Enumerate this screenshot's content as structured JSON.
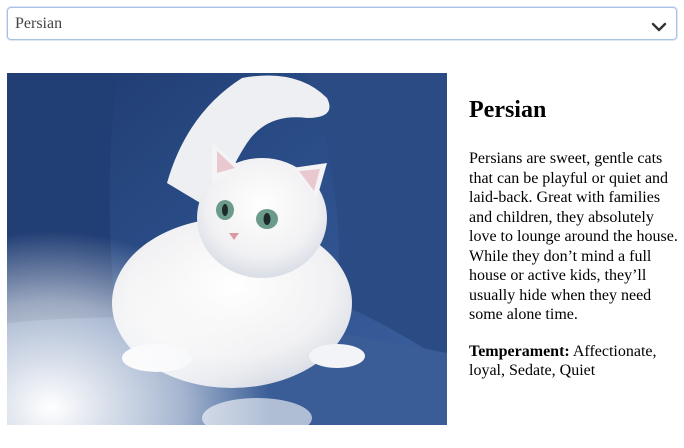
{
  "breed_select": {
    "selected": "Persian",
    "icon": "chevron-down-icon"
  },
  "photo": {
    "alt": "Persian"
  },
  "breed": {
    "name": "Persian",
    "description": "Persians are sweet, gentle cats that can be playful or quiet and laid-back. Great with families and children, they absolutely love to lounge around the house. While they don’t mind a full house or active kids, they’ll usually hide when they need some alone time.",
    "temperament_label": "Temperament:",
    "temperament": "Affectionate, loyal, Sedate, Quiet"
  }
}
